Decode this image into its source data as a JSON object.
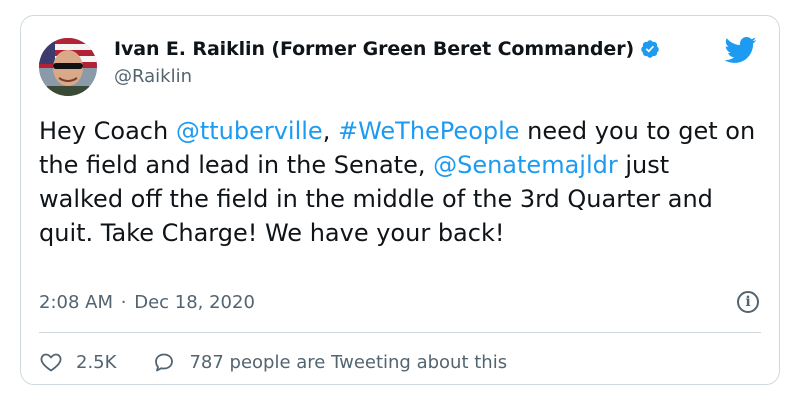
{
  "author": {
    "display_name": "Ivan E. Raiklin (Former Green Beret Commander)",
    "handle": "@Raiklin",
    "verified": true
  },
  "tweet": {
    "text_segments": [
      {
        "type": "text",
        "value": "Hey Coach "
      },
      {
        "type": "link",
        "value": "@ttuberville"
      },
      {
        "type": "text",
        "value": ", "
      },
      {
        "type": "link",
        "value": "#WeThePeople"
      },
      {
        "type": "text",
        "value": " need you to get on the field and lead in the Senate, "
      },
      {
        "type": "link",
        "value": "@Senatemajldr"
      },
      {
        "type": "text",
        "value": " just walked off the field in the middle of the 3rd Quarter and quit.  Take Charge!  We have your back!"
      }
    ],
    "time": "2:08 AM",
    "separator": "·",
    "date": "Dec 18, 2020"
  },
  "actions": {
    "likes": "2.5K",
    "replies_text": "787 people are Tweeting about this"
  },
  "icons": {
    "brand": "twitter-bird-icon",
    "verified": "verified-badge-icon",
    "info": "info-icon",
    "like": "heart-icon",
    "reply": "speech-bubble-icon"
  },
  "colors": {
    "link": "#1d9bf0",
    "text": "#0f1419",
    "secondary": "#536471",
    "border": "#cfd9de"
  }
}
